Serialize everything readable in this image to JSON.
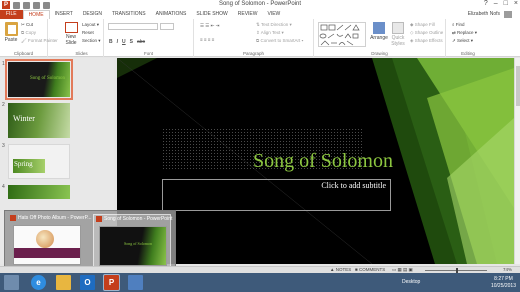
{
  "window": {
    "title": "Song of Solomon - PowerPoint",
    "app_icon_letter": "P",
    "controls": [
      "?",
      "–",
      "□",
      "×"
    ]
  },
  "ribbon_tabs": [
    "FILE",
    "HOME",
    "INSERT",
    "DESIGN",
    "TRANSITIONS",
    "ANIMATIONS",
    "SLIDE SHOW",
    "REVIEW",
    "VIEW"
  ],
  "active_tab": "HOME",
  "user": {
    "name": "Elizabeth Nofs"
  },
  "ribbon": {
    "clipboard": {
      "paste": "Paste",
      "cut": "Cut",
      "copy": "Copy",
      "format_painter": "Format Painter",
      "label": "Clipboard"
    },
    "slides": {
      "new_slide": "New Slide",
      "layout": "Layout",
      "reset": "Reset",
      "section": "Section",
      "label": "Slides"
    },
    "font": {
      "label": "Font",
      "bold": "B",
      "italic": "I",
      "underline": "U",
      "strike": "S",
      "abc": "abc"
    },
    "paragraph": {
      "text_direction": "Text Direction",
      "align_text": "Align Text",
      "convert": "Convert to SmartArt",
      "label": "Paragraph"
    },
    "drawing": {
      "arrange": "Arrange",
      "quick_styles": "Quick Styles",
      "shape_fill": "Shape Fill",
      "shape_outline": "Shape Outline",
      "shape_effects": "Shape Effects",
      "label": "Drawing"
    },
    "editing": {
      "find": "Find",
      "replace": "Replace",
      "select": "Select",
      "label": "Editing"
    }
  },
  "thumbnails": [
    {
      "num": "1",
      "title": "Song of Solomon"
    },
    {
      "num": "2",
      "title": "Winter"
    },
    {
      "num": "3",
      "title": "Spring"
    },
    {
      "num": "4",
      "title": ""
    }
  ],
  "slide": {
    "title": "Song of Solomon",
    "subtitle_placeholder": "Click to add subtitle"
  },
  "taskbar_preview": [
    {
      "title": "Hats Off Photo Album - PowerP..."
    },
    {
      "title": "Song of Solomon - PowerPoint"
    }
  ],
  "statusbar": {
    "notes": "NOTES",
    "comments": "COMMENTS",
    "zoom": "74%"
  },
  "taskbar": {
    "desktop": "Desktop",
    "time": "8:27 PM",
    "date": "10/25/2013"
  },
  "colors": {
    "accent": "#c43e1c",
    "slide_title": "#8cc640"
  }
}
